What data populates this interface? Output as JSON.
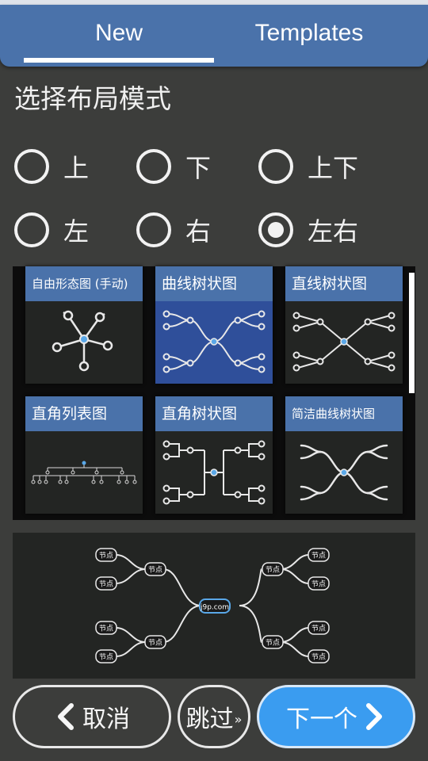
{
  "tabs": {
    "new_label": "New",
    "templates_label": "Templates"
  },
  "heading": "选择布局模式",
  "layout_options": [
    {
      "label": "上",
      "selected": false
    },
    {
      "label": "下",
      "selected": false
    },
    {
      "label": "上下",
      "selected": false
    },
    {
      "label": "左",
      "selected": false
    },
    {
      "label": "右",
      "selected": false
    },
    {
      "label": "左右",
      "selected": true
    }
  ],
  "style_cards": [
    {
      "label": "自由形态图 (手动)",
      "selected": false
    },
    {
      "label": "曲线树状图",
      "selected": true
    },
    {
      "label": "直线树状图",
      "selected": false
    },
    {
      "label": "直角列表图",
      "selected": false
    },
    {
      "label": "直角树状图",
      "selected": false
    },
    {
      "label": "简洁曲线树状图",
      "selected": false
    }
  ],
  "preview": {
    "root_label": "j9p.com",
    "node_label": "节点"
  },
  "buttons": {
    "cancel": "取消",
    "skip": "跳过",
    "skip_arrow": "»",
    "next": "下一个"
  },
  "colors": {
    "accent": "#4a72aa",
    "next_button": "#3a9cf0",
    "background": "#3c3d3b"
  }
}
